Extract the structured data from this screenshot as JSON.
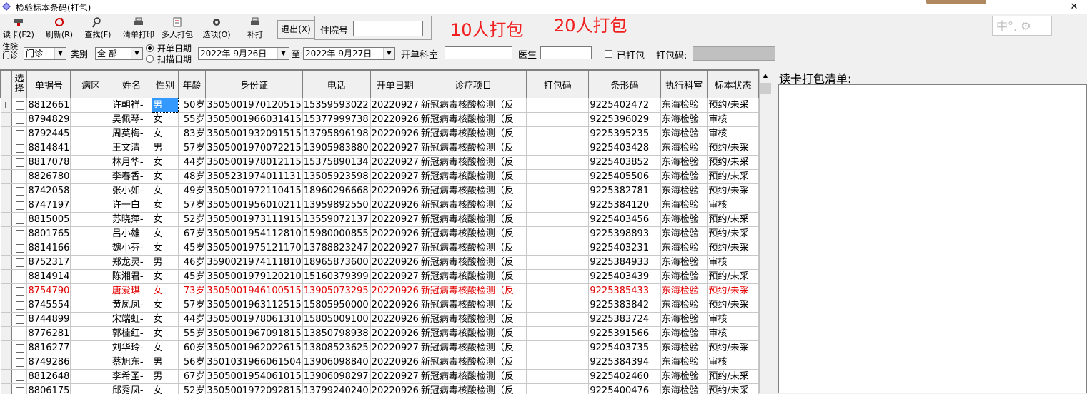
{
  "window": {
    "title": "检验标本条码(打包)"
  },
  "toolbar": {
    "buttons": [
      {
        "label": "读卡(F2)",
        "icon": "card-reader-icon"
      },
      {
        "label": "刷新(R)",
        "icon": "refresh-icon"
      },
      {
        "label": "查找(F)",
        "icon": "search-icon"
      },
      {
        "label": "清单打印",
        "icon": "printer-icon"
      },
      {
        "label": "多人打包",
        "icon": "package-icon"
      },
      {
        "label": "选项(O)",
        "icon": "gear-icon"
      },
      {
        "label": "补打",
        "icon": "printer-icon"
      }
    ],
    "exit_label": "退出(X)",
    "inpatient_label": "住院号",
    "inpatient_value": ""
  },
  "annotations": {
    "note1": "10人打包",
    "note2": "20人打包"
  },
  "ime": {
    "text": "中°,"
  },
  "filters": {
    "type_label_top": "住院",
    "type_label_bottom": "门诊",
    "type_value": "门诊",
    "category_label": "类别",
    "category_value": "全   部",
    "date_mode_1": "开单日期",
    "date_mode_2": "扫描日期",
    "date_from": "2022年  9月26日",
    "to_label": "至",
    "date_to": "2022年  9月27日",
    "dept_label": "开单科室",
    "dept_value": "",
    "doctor_label": "医生",
    "doctor_value": "",
    "packed_label": "已打包",
    "pack_code_label": "打包码:"
  },
  "grid": {
    "columns": [
      "选择",
      "单据号",
      "病区",
      "姓名",
      "性别",
      "年龄",
      "身份证",
      "电话",
      "开单日期",
      "诊疗项目",
      "打包码",
      "条形码",
      "执行科室",
      "标本状态"
    ],
    "rows": [
      {
        "id": "8812661",
        "ward": "",
        "name": "许朝祥-",
        "sex": "男",
        "age": "50岁",
        "idcard": "3505001970120515",
        "phone": "15359593022",
        "date": "20220927",
        "item": "新冠病毒核酸检测（反",
        "pack": "",
        "barcode": "9225402472",
        "dept": "东海检验",
        "status": "预约/未采"
      },
      {
        "id": "8794829",
        "ward": "",
        "name": "吴佩琴-",
        "sex": "女",
        "age": "55岁",
        "idcard": "3505001966031415",
        "phone": "15377999738",
        "date": "20220926",
        "item": "新冠病毒核酸检测（反",
        "pack": "",
        "barcode": "9225396029",
        "dept": "东海检验",
        "status": "审核"
      },
      {
        "id": "8792445",
        "ward": "",
        "name": "周英梅-",
        "sex": "女",
        "age": "83岁",
        "idcard": "3505001932091515",
        "phone": "13795896198",
        "date": "20220926",
        "item": "新冠病毒核酸检测（反",
        "pack": "",
        "barcode": "9225395235",
        "dept": "东海检验",
        "status": "审核"
      },
      {
        "id": "8814841",
        "ward": "",
        "name": "王文清-",
        "sex": "男",
        "age": "57岁",
        "idcard": "3505001970072215",
        "phone": "13905983880",
        "date": "20220927",
        "item": "新冠病毒核酸检测（反",
        "pack": "",
        "barcode": "9225403428",
        "dept": "东海检验",
        "status": "预约/未采"
      },
      {
        "id": "8817078",
        "ward": "",
        "name": "林月华-",
        "sex": "女",
        "age": "44岁",
        "idcard": "3505001978012115",
        "phone": "15375890134",
        "date": "20220927",
        "item": "新冠病毒核酸检测（反",
        "pack": "",
        "barcode": "9225403852",
        "dept": "东海检验",
        "status": "预约/未采"
      },
      {
        "id": "8826780",
        "ward": "",
        "name": "李春香-",
        "sex": "女",
        "age": "48岁",
        "idcard": "3505231974011131",
        "phone": "13505923598",
        "date": "20220927",
        "item": "新冠病毒核酸检测（反",
        "pack": "",
        "barcode": "9225405506",
        "dept": "东海检验",
        "status": "预约/未采"
      },
      {
        "id": "8742058",
        "ward": "",
        "name": "张小如-",
        "sex": "女",
        "age": "49岁",
        "idcard": "3505001972110415",
        "phone": "18960296668",
        "date": "20220926",
        "item": "新冠病毒核酸检测（反",
        "pack": "",
        "barcode": "9225382781",
        "dept": "东海检验",
        "status": "预约/未采"
      },
      {
        "id": "8747197",
        "ward": "",
        "name": "许一白",
        "sex": "女",
        "age": "57岁",
        "idcard": "3505001956010211",
        "phone": "13959892550",
        "date": "20220926",
        "item": "新冠病毒核酸检测（反",
        "pack": "",
        "barcode": "9225384120",
        "dept": "东海检验",
        "status": "审核"
      },
      {
        "id": "8815005",
        "ward": "",
        "name": "苏晓萍-",
        "sex": "女",
        "age": "52岁",
        "idcard": "3505001973111915",
        "phone": "13559072137",
        "date": "20220927",
        "item": "新冠病毒核酸检测（反",
        "pack": "",
        "barcode": "9225403456",
        "dept": "东海检验",
        "status": "预约/未采"
      },
      {
        "id": "8801765",
        "ward": "",
        "name": "吕小雄",
        "sex": "女",
        "age": "67岁",
        "idcard": "3505001954112810",
        "phone": "15980000855",
        "date": "20220926",
        "item": "新冠病毒核酸检测（反",
        "pack": "",
        "barcode": "9225398893",
        "dept": "东海检验",
        "status": "预约/未采"
      },
      {
        "id": "8814166",
        "ward": "",
        "name": "魏小芬-",
        "sex": "女",
        "age": "45岁",
        "idcard": "3505001975121170",
        "phone": "13788823247",
        "date": "20220927",
        "item": "新冠病毒核酸检测（反",
        "pack": "",
        "barcode": "9225403231",
        "dept": "东海检验",
        "status": "预约/未采"
      },
      {
        "id": "8752317",
        "ward": "",
        "name": "郑龙灵-",
        "sex": "男",
        "age": "46岁",
        "idcard": "3590021974111810",
        "phone": "18965873600",
        "date": "20220926",
        "item": "新冠病毒核酸检测（反",
        "pack": "",
        "barcode": "9225384933",
        "dept": "东海检验",
        "status": "审核"
      },
      {
        "id": "8814914",
        "ward": "",
        "name": "陈湘君-",
        "sex": "女",
        "age": "45岁",
        "idcard": "3505001979120210",
        "phone": "15160379399",
        "date": "20220927",
        "item": "新冠病毒核酸检测（反",
        "pack": "",
        "barcode": "9225403439",
        "dept": "东海检验",
        "status": "预约/未采"
      },
      {
        "id": "8754790",
        "ward": "",
        "name": "唐爱琪",
        "sex": "女",
        "age": "73岁",
        "idcard": "3505001946100515",
        "phone": "13905073295",
        "date": "20220926",
        "item": "新冠病毒核酸检测（反",
        "pack": "",
        "barcode": "9225385433",
        "dept": "东海检验",
        "status": "预约/未采",
        "red": true
      },
      {
        "id": "8745554",
        "ward": "",
        "name": "黄凤凤-",
        "sex": "女",
        "age": "57岁",
        "idcard": "3505001963112515",
        "phone": "15805950000",
        "date": "20220926",
        "item": "新冠病毒核酸检测（反",
        "pack": "",
        "barcode": "9225383842",
        "dept": "东海检验",
        "status": "预约/未采"
      },
      {
        "id": "8744899",
        "ward": "",
        "name": "宋端虹-",
        "sex": "女",
        "age": "44岁",
        "idcard": "3505001978061310",
        "phone": "15805009100",
        "date": "20220926",
        "item": "新冠病毒核酸检测（反",
        "pack": "",
        "barcode": "9225383724",
        "dept": "东海检验",
        "status": "审核"
      },
      {
        "id": "8776281",
        "ward": "",
        "name": "郭桂红-",
        "sex": "女",
        "age": "55岁",
        "idcard": "3505001967091815",
        "phone": "13850798938",
        "date": "20220926",
        "item": "新冠病毒核酸检测（反",
        "pack": "",
        "barcode": "9225391566",
        "dept": "东海检验",
        "status": "审核"
      },
      {
        "id": "8816277",
        "ward": "",
        "name": "刘华玲-",
        "sex": "女",
        "age": "60岁",
        "idcard": "3505001962022615",
        "phone": "13808523625",
        "date": "20220927",
        "item": "新冠病毒核酸检测（反",
        "pack": "",
        "barcode": "9225403735",
        "dept": "东海检验",
        "status": "预约/未采"
      },
      {
        "id": "8749286",
        "ward": "",
        "name": "蔡旭东-",
        "sex": "男",
        "age": "56岁",
        "idcard": "3501031966061504",
        "phone": "13906098840",
        "date": "20220926",
        "item": "新冠病毒核酸检测（反",
        "pack": "",
        "barcode": "9225384394",
        "dept": "东海检验",
        "status": "审核"
      },
      {
        "id": "8812648",
        "ward": "",
        "name": "李希圣-",
        "sex": "男",
        "age": "67岁",
        "idcard": "3505001954061015",
        "phone": "13906098297",
        "date": "20220927",
        "item": "新冠病毒核酸检测（反",
        "pack": "",
        "barcode": "9225402460",
        "dept": "东海检验",
        "status": "预约/未采"
      },
      {
        "id": "8806175",
        "ward": "",
        "name": "邱秀凤-",
        "sex": "女",
        "age": "52岁",
        "idcard": "3505001972092815",
        "phone": "13799240240",
        "date": "20220926",
        "item": "新冠病毒核酸检测（反",
        "pack": "",
        "barcode": "9225400476",
        "dept": "东海检验",
        "status": "预约/未采"
      }
    ],
    "current_row_marker": "I"
  },
  "right_panel": {
    "title": "读卡打包清单:"
  },
  "colors": {
    "highlight": "#3399ff",
    "red_row": "#e00000",
    "annotation": "#f02020"
  }
}
